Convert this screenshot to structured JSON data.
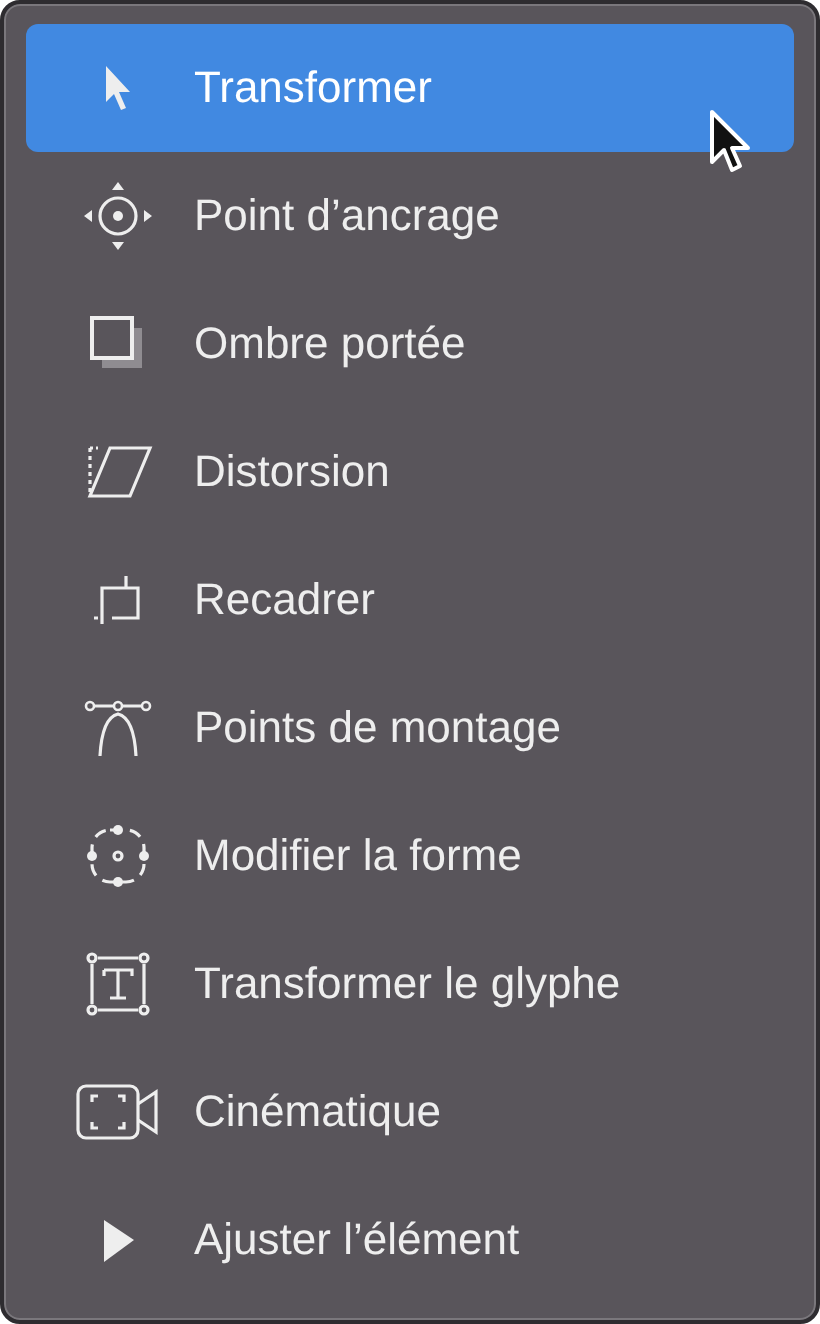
{
  "menu": {
    "items": [
      {
        "label": "Transformer",
        "kind": "arrow",
        "selected": true
      },
      {
        "label": "Point d’ancrage",
        "kind": "anchor",
        "selected": false
      },
      {
        "label": "Ombre portée",
        "kind": "shadow",
        "selected": false
      },
      {
        "label": "Distorsion",
        "kind": "distort",
        "selected": false
      },
      {
        "label": "Recadrer",
        "kind": "crop",
        "selected": false
      },
      {
        "label": "Points de montage",
        "kind": "curve",
        "selected": false
      },
      {
        "label": "Modifier la forme",
        "kind": "shape",
        "selected": false
      },
      {
        "label": "Transformer le glyphe",
        "kind": "glyph",
        "selected": false
      },
      {
        "label": "Cinématique",
        "kind": "camera",
        "selected": false
      },
      {
        "label": "Ajuster l’élément",
        "kind": "play",
        "selected": false
      }
    ]
  }
}
